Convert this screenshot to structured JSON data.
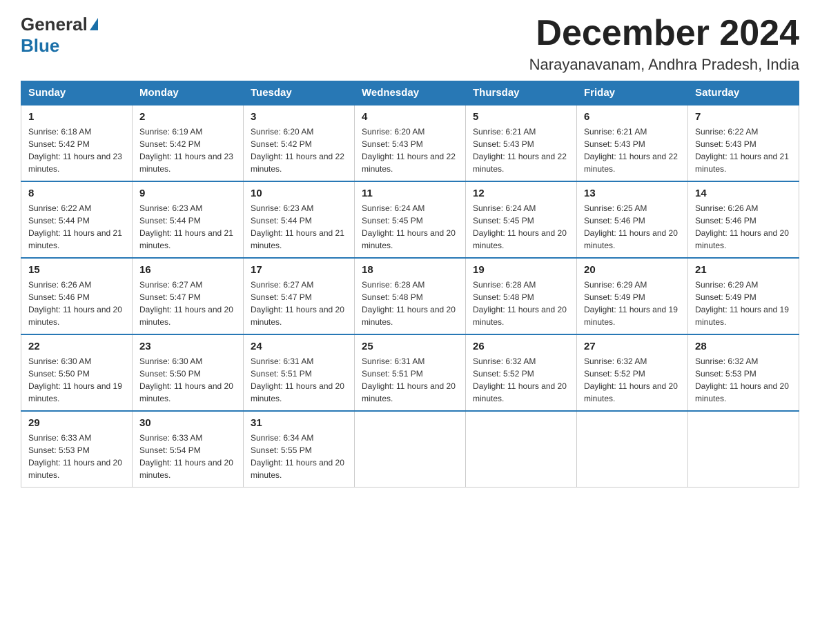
{
  "header": {
    "logo_general": "General",
    "logo_blue": "Blue",
    "month_title": "December 2024",
    "location": "Narayanavanam, Andhra Pradesh, India"
  },
  "weekdays": [
    "Sunday",
    "Monday",
    "Tuesday",
    "Wednesday",
    "Thursday",
    "Friday",
    "Saturday"
  ],
  "weeks": [
    [
      {
        "day": "1",
        "sunrise": "6:18 AM",
        "sunset": "5:42 PM",
        "daylight": "11 hours and 23 minutes."
      },
      {
        "day": "2",
        "sunrise": "6:19 AM",
        "sunset": "5:42 PM",
        "daylight": "11 hours and 23 minutes."
      },
      {
        "day": "3",
        "sunrise": "6:20 AM",
        "sunset": "5:42 PM",
        "daylight": "11 hours and 22 minutes."
      },
      {
        "day": "4",
        "sunrise": "6:20 AM",
        "sunset": "5:43 PM",
        "daylight": "11 hours and 22 minutes."
      },
      {
        "day": "5",
        "sunrise": "6:21 AM",
        "sunset": "5:43 PM",
        "daylight": "11 hours and 22 minutes."
      },
      {
        "day": "6",
        "sunrise": "6:21 AM",
        "sunset": "5:43 PM",
        "daylight": "11 hours and 22 minutes."
      },
      {
        "day": "7",
        "sunrise": "6:22 AM",
        "sunset": "5:43 PM",
        "daylight": "11 hours and 21 minutes."
      }
    ],
    [
      {
        "day": "8",
        "sunrise": "6:22 AM",
        "sunset": "5:44 PM",
        "daylight": "11 hours and 21 minutes."
      },
      {
        "day": "9",
        "sunrise": "6:23 AM",
        "sunset": "5:44 PM",
        "daylight": "11 hours and 21 minutes."
      },
      {
        "day": "10",
        "sunrise": "6:23 AM",
        "sunset": "5:44 PM",
        "daylight": "11 hours and 21 minutes."
      },
      {
        "day": "11",
        "sunrise": "6:24 AM",
        "sunset": "5:45 PM",
        "daylight": "11 hours and 20 minutes."
      },
      {
        "day": "12",
        "sunrise": "6:24 AM",
        "sunset": "5:45 PM",
        "daylight": "11 hours and 20 minutes."
      },
      {
        "day": "13",
        "sunrise": "6:25 AM",
        "sunset": "5:46 PM",
        "daylight": "11 hours and 20 minutes."
      },
      {
        "day": "14",
        "sunrise": "6:26 AM",
        "sunset": "5:46 PM",
        "daylight": "11 hours and 20 minutes."
      }
    ],
    [
      {
        "day": "15",
        "sunrise": "6:26 AM",
        "sunset": "5:46 PM",
        "daylight": "11 hours and 20 minutes."
      },
      {
        "day": "16",
        "sunrise": "6:27 AM",
        "sunset": "5:47 PM",
        "daylight": "11 hours and 20 minutes."
      },
      {
        "day": "17",
        "sunrise": "6:27 AM",
        "sunset": "5:47 PM",
        "daylight": "11 hours and 20 minutes."
      },
      {
        "day": "18",
        "sunrise": "6:28 AM",
        "sunset": "5:48 PM",
        "daylight": "11 hours and 20 minutes."
      },
      {
        "day": "19",
        "sunrise": "6:28 AM",
        "sunset": "5:48 PM",
        "daylight": "11 hours and 20 minutes."
      },
      {
        "day": "20",
        "sunrise": "6:29 AM",
        "sunset": "5:49 PM",
        "daylight": "11 hours and 19 minutes."
      },
      {
        "day": "21",
        "sunrise": "6:29 AM",
        "sunset": "5:49 PM",
        "daylight": "11 hours and 19 minutes."
      }
    ],
    [
      {
        "day": "22",
        "sunrise": "6:30 AM",
        "sunset": "5:50 PM",
        "daylight": "11 hours and 19 minutes."
      },
      {
        "day": "23",
        "sunrise": "6:30 AM",
        "sunset": "5:50 PM",
        "daylight": "11 hours and 20 minutes."
      },
      {
        "day": "24",
        "sunrise": "6:31 AM",
        "sunset": "5:51 PM",
        "daylight": "11 hours and 20 minutes."
      },
      {
        "day": "25",
        "sunrise": "6:31 AM",
        "sunset": "5:51 PM",
        "daylight": "11 hours and 20 minutes."
      },
      {
        "day": "26",
        "sunrise": "6:32 AM",
        "sunset": "5:52 PM",
        "daylight": "11 hours and 20 minutes."
      },
      {
        "day": "27",
        "sunrise": "6:32 AM",
        "sunset": "5:52 PM",
        "daylight": "11 hours and 20 minutes."
      },
      {
        "day": "28",
        "sunrise": "6:32 AM",
        "sunset": "5:53 PM",
        "daylight": "11 hours and 20 minutes."
      }
    ],
    [
      {
        "day": "29",
        "sunrise": "6:33 AM",
        "sunset": "5:53 PM",
        "daylight": "11 hours and 20 minutes."
      },
      {
        "day": "30",
        "sunrise": "6:33 AM",
        "sunset": "5:54 PM",
        "daylight": "11 hours and 20 minutes."
      },
      {
        "day": "31",
        "sunrise": "6:34 AM",
        "sunset": "5:55 PM",
        "daylight": "11 hours and 20 minutes."
      },
      null,
      null,
      null,
      null
    ]
  ]
}
